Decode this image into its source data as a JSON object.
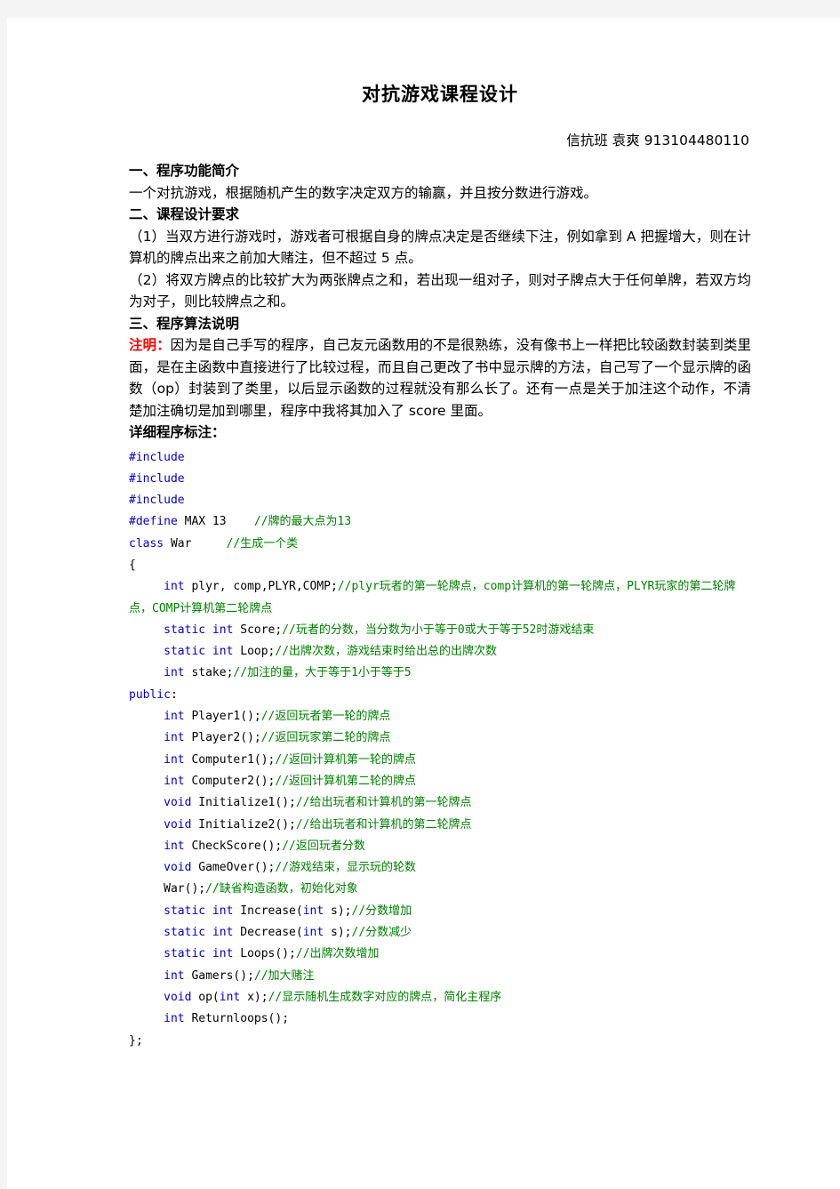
{
  "document": {
    "title": "对抗游戏课程设计",
    "author_line": "信抗班  袁爽 913104480110",
    "sections": [
      {
        "heading": "一、程序功能简介",
        "paragraphs": [
          "一个对抗游戏，根据随机产生的数字决定双方的输赢，并且按分数进行游戏。"
        ]
      },
      {
        "heading": "二、课程设计要求",
        "paragraphs": [
          "（1）当双方进行游戏时，游戏者可根据自身的牌点决定是否继续下注，例如拿到 A 把握增大，则在计算机的牌点出来之前加大赌注，但不超过 5 点。",
          "（2）将双方牌点的比较扩大为两张牌点之和，若出现一组对子，则对子牌点大于任何单牌，若双方均为对子，则比较牌点之和。"
        ]
      },
      {
        "heading": "三、程序算法说明",
        "paragraphs": []
      }
    ],
    "note": {
      "label": "注明：",
      "body": "因为是自己手写的程序，自己友元函数用的不是很熟练，没有像书上一样把比较函数封装到类里面，是在主函数中直接进行了比较过程，而且自己更改了书中显示牌的方法，自己写了一个显示牌的函数（op）封装到了类里，以后显示函数的过程就没有那么长了。还有一点是关于加注这个动作，不清楚加注确切是加到哪里，程序中我将其加入了 score 里面。"
    },
    "code_heading": "详细程序标注："
  },
  "code": {
    "colors": {
      "keyword": "#0000c8",
      "comment": "#008000",
      "plain": "#000000",
      "note_red": "#ff0000"
    },
    "lines": [
      [
        {
          "t": "kw",
          "s": "#include"
        }
      ],
      [
        {
          "t": "kw",
          "s": "#include"
        }
      ],
      [
        {
          "t": "kw",
          "s": "#include"
        }
      ],
      [
        {
          "t": "kw",
          "s": "#define"
        },
        {
          "t": "pl",
          "s": " MAX 13    "
        },
        {
          "t": "cmt",
          "s": "//牌的最大点为13"
        }
      ],
      [
        {
          "t": "kw",
          "s": "class"
        },
        {
          "t": "pl",
          "s": " War     "
        },
        {
          "t": "cmt",
          "s": "//生成一个类"
        }
      ],
      [
        {
          "t": "pl",
          "s": "{"
        }
      ],
      [
        {
          "t": "pl",
          "s": "     "
        },
        {
          "t": "kw",
          "s": "int"
        },
        {
          "t": "pl",
          "s": " plyr, comp,PLYR,COMP;"
        },
        {
          "t": "cmt",
          "s": "//plyr玩者的第一轮牌点，comp计算机的第一轮牌点，PLYR玩家的第二轮牌点，COMP计算机第二轮牌点"
        }
      ],
      [
        {
          "t": "pl",
          "s": "     "
        },
        {
          "t": "kw",
          "s": "static int"
        },
        {
          "t": "pl",
          "s": " Score;"
        },
        {
          "t": "cmt",
          "s": "//玩者的分数，当分数为小于等于0或大于等于52时游戏结束"
        }
      ],
      [
        {
          "t": "pl",
          "s": "     "
        },
        {
          "t": "kw",
          "s": "static int"
        },
        {
          "t": "pl",
          "s": " Loop;"
        },
        {
          "t": "cmt",
          "s": "//出牌次数，游戏结束时给出总的出牌次数"
        }
      ],
      [
        {
          "t": "pl",
          "s": "     "
        },
        {
          "t": "kw",
          "s": "int"
        },
        {
          "t": "pl",
          "s": " stake;"
        },
        {
          "t": "cmt",
          "s": "//加注的量，大于等于1小于等于5"
        }
      ],
      [
        {
          "t": "kw",
          "s": "public"
        },
        {
          "t": "pl",
          "s": ":"
        }
      ],
      [
        {
          "t": "pl",
          "s": "     "
        },
        {
          "t": "kw",
          "s": "int"
        },
        {
          "t": "pl",
          "s": " Player1();"
        },
        {
          "t": "cmt",
          "s": "//返回玩者第一轮的牌点"
        }
      ],
      [
        {
          "t": "pl",
          "s": "     "
        },
        {
          "t": "kw",
          "s": "int"
        },
        {
          "t": "pl",
          "s": " Player2();"
        },
        {
          "t": "cmt",
          "s": "//返回玩家第二轮的牌点"
        }
      ],
      [
        {
          "t": "pl",
          "s": "     "
        },
        {
          "t": "kw",
          "s": "int"
        },
        {
          "t": "pl",
          "s": " Computer1();"
        },
        {
          "t": "cmt",
          "s": "//返回计算机第一轮的牌点"
        }
      ],
      [
        {
          "t": "pl",
          "s": "     "
        },
        {
          "t": "kw",
          "s": "int"
        },
        {
          "t": "pl",
          "s": " Computer2();"
        },
        {
          "t": "cmt",
          "s": "//返回计算机第二轮的牌点"
        }
      ],
      [
        {
          "t": "pl",
          "s": "     "
        },
        {
          "t": "kw",
          "s": "void"
        },
        {
          "t": "pl",
          "s": " Initialize1();"
        },
        {
          "t": "cmt",
          "s": "//给出玩者和计算机的第一轮牌点"
        }
      ],
      [
        {
          "t": "pl",
          "s": "     "
        },
        {
          "t": "kw",
          "s": "void"
        },
        {
          "t": "pl",
          "s": " Initialize2();"
        },
        {
          "t": "cmt",
          "s": "//给出玩者和计算机的第二轮牌点"
        }
      ],
      [
        {
          "t": "pl",
          "s": "     "
        },
        {
          "t": "kw",
          "s": "int"
        },
        {
          "t": "pl",
          "s": " CheckScore();"
        },
        {
          "t": "cmt",
          "s": "//返回玩者分数"
        }
      ],
      [
        {
          "t": "pl",
          "s": "     "
        },
        {
          "t": "kw",
          "s": "void"
        },
        {
          "t": "pl",
          "s": " GameOver();"
        },
        {
          "t": "cmt",
          "s": "//游戏结束，显示玩的轮数"
        }
      ],
      [
        {
          "t": "pl",
          "s": "     War();"
        },
        {
          "t": "cmt",
          "s": "//缺省构造函数，初始化对象"
        }
      ],
      [
        {
          "t": "pl",
          "s": "     "
        },
        {
          "t": "kw",
          "s": "static int"
        },
        {
          "t": "pl",
          "s": " Increase("
        },
        {
          "t": "kw",
          "s": "int"
        },
        {
          "t": "pl",
          "s": " s);"
        },
        {
          "t": "cmt",
          "s": "//分数增加"
        }
      ],
      [
        {
          "t": "pl",
          "s": "     "
        },
        {
          "t": "kw",
          "s": "static int"
        },
        {
          "t": "pl",
          "s": " Decrease("
        },
        {
          "t": "kw",
          "s": "int"
        },
        {
          "t": "pl",
          "s": " s);"
        },
        {
          "t": "cmt",
          "s": "//分数减少"
        }
      ],
      [
        {
          "t": "pl",
          "s": "     "
        },
        {
          "t": "kw",
          "s": "static int"
        },
        {
          "t": "pl",
          "s": " Loops();"
        },
        {
          "t": "cmt",
          "s": "//出牌次数增加"
        }
      ],
      [
        {
          "t": "pl",
          "s": "     "
        },
        {
          "t": "kw",
          "s": "int"
        },
        {
          "t": "pl",
          "s": " Gamers();"
        },
        {
          "t": "cmt",
          "s": "//加大赌注"
        }
      ],
      [
        {
          "t": "pl",
          "s": "     "
        },
        {
          "t": "kw",
          "s": "void"
        },
        {
          "t": "pl",
          "s": " op("
        },
        {
          "t": "kw",
          "s": "int"
        },
        {
          "t": "pl",
          "s": " x);"
        },
        {
          "t": "cmt",
          "s": "//显示随机生成数字对应的牌点，简化主程序"
        }
      ],
      [
        {
          "t": "pl",
          "s": "     "
        },
        {
          "t": "kw",
          "s": "int"
        },
        {
          "t": "pl",
          "s": " Returnloops();"
        }
      ],
      [
        {
          "t": "pl",
          "s": "};"
        }
      ]
    ]
  }
}
